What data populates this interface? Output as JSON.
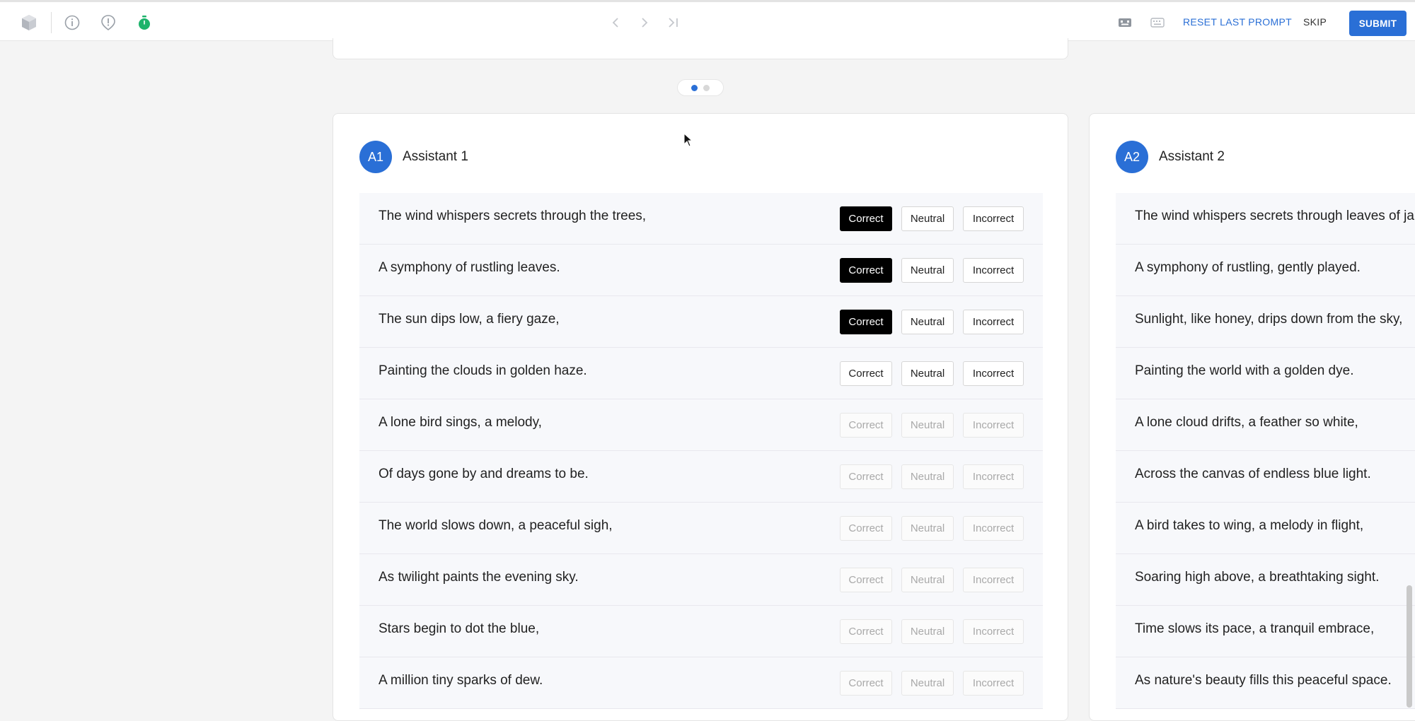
{
  "toolbar": {
    "icons": [
      "cube-icon",
      "info-icon",
      "alert-icon",
      "timer-icon"
    ],
    "nav": [
      "chevron-left-icon",
      "chevron-right-icon",
      "skip-to-end-icon"
    ],
    "right_icons": [
      "keyboard-shortcut-icon",
      "keyboard-icon"
    ],
    "reset_label": "RESET LAST PROMPT",
    "skip_label": "SKIP",
    "submit_label": "SUBMIT"
  },
  "pager": {
    "count": 2,
    "active": 0
  },
  "buttons": {
    "correct": "Correct",
    "neutral": "Neutral",
    "incorrect": "Incorrect"
  },
  "assistant1": {
    "badge": "A1",
    "name": "Assistant 1",
    "lines": [
      {
        "text": "The wind whispers secrets through the trees,",
        "rating": "correct",
        "state": "active"
      },
      {
        "text": "A symphony of rustling leaves.",
        "rating": "correct",
        "state": "active"
      },
      {
        "text": "The sun dips low, a fiery gaze,",
        "rating": "correct",
        "state": "active"
      },
      {
        "text": "Painting the clouds in golden haze.",
        "rating": "none",
        "state": "active"
      },
      {
        "text": "A lone bird sings, a melody,",
        "rating": "none",
        "state": "faded"
      },
      {
        "text": "Of days gone by and dreams to be.",
        "rating": "none",
        "state": "faded"
      },
      {
        "text": "The world slows down, a peaceful sigh,",
        "rating": "none",
        "state": "faded"
      },
      {
        "text": "As twilight paints the evening sky.",
        "rating": "none",
        "state": "faded"
      },
      {
        "text": "Stars begin to dot the blue,",
        "rating": "none",
        "state": "faded"
      },
      {
        "text": "A million tiny sparks of dew.",
        "rating": "none",
        "state": "faded"
      }
    ]
  },
  "assistant2": {
    "badge": "A2",
    "name": "Assistant 2",
    "lines": [
      "The wind whispers secrets through leaves of ja",
      "A symphony of rustling, gently played.",
      "Sunlight, like honey, drips down from the sky,",
      "Painting the world with a golden dye.",
      "A lone cloud drifts, a feather so white,",
      "Across the canvas of endless blue light.",
      "A bird takes to wing, a melody in flight,",
      "Soaring high above, a breathtaking sight.",
      "Time slows its pace, a tranquil embrace,",
      "As nature's beauty fills this peaceful space."
    ]
  },
  "colors": {
    "accent": "#2a6fd6",
    "timer": "#1db36b",
    "selected": "#000000"
  }
}
